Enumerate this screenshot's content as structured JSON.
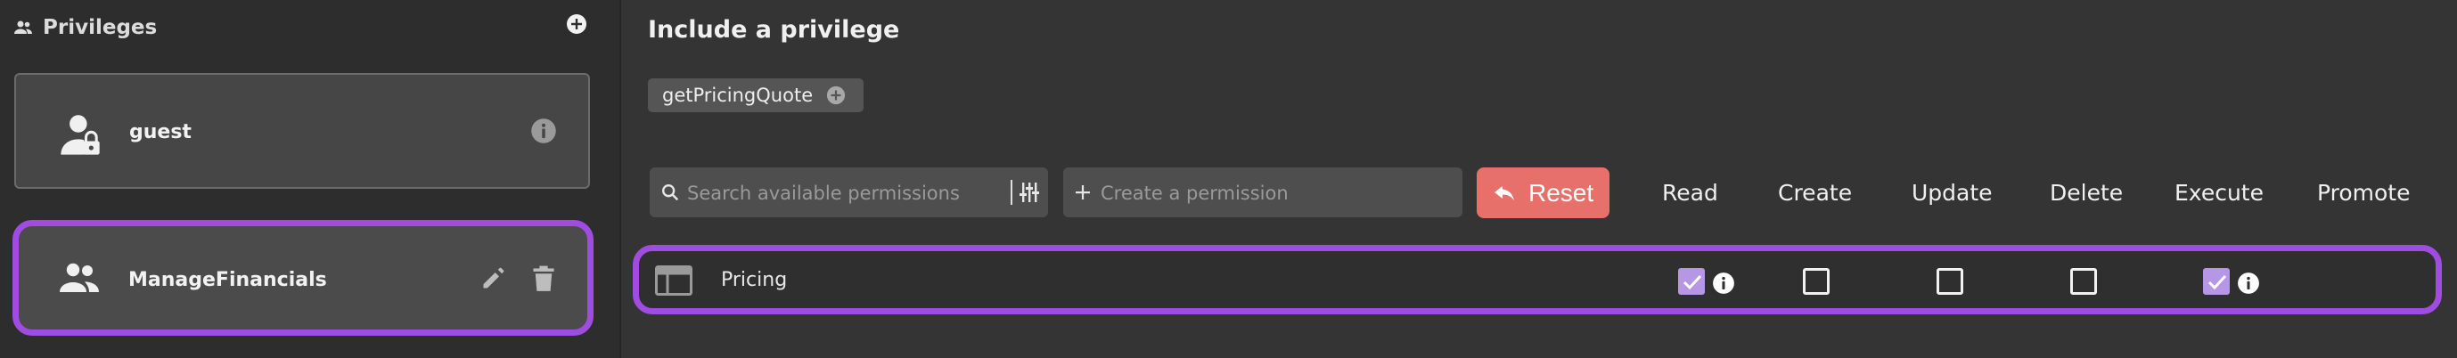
{
  "sidebar": {
    "title": "Privileges",
    "header_icon": "people-icon",
    "add_icon": "add-circle-icon",
    "items": [
      {
        "name": "guest",
        "icon": "lock-person-icon",
        "action_icon": "info-icon",
        "selected": false
      },
      {
        "name": "ManageFinancials",
        "icon": "people-icon",
        "actions": [
          "edit-icon",
          "trash-icon"
        ],
        "selected": true
      }
    ]
  },
  "main": {
    "title": "Include a privilege",
    "chip": {
      "label": "getPricingQuote",
      "icon": "add-circle-icon"
    },
    "search": {
      "placeholder": "Search available permissions",
      "icon": "search-icon",
      "filter_icon": "filter-sliders-icon"
    },
    "create": {
      "placeholder": "Create a permission",
      "icon": "plus-icon"
    },
    "reset": {
      "label": "Reset",
      "icon": "undo-arrow-icon"
    },
    "columns": [
      "Read",
      "Create",
      "Update",
      "Delete",
      "Execute",
      "Promote"
    ],
    "rows": [
      {
        "name": "Pricing",
        "icon": "table-icon",
        "read": true,
        "create": false,
        "update": false,
        "delete": false,
        "execute": true
      }
    ]
  },
  "colors": {
    "accent_purple": "#a14ce0",
    "checked": "#b597e6",
    "reset": "#e8706a",
    "background": "#343434",
    "sidebar": "#2d2d2d"
  }
}
